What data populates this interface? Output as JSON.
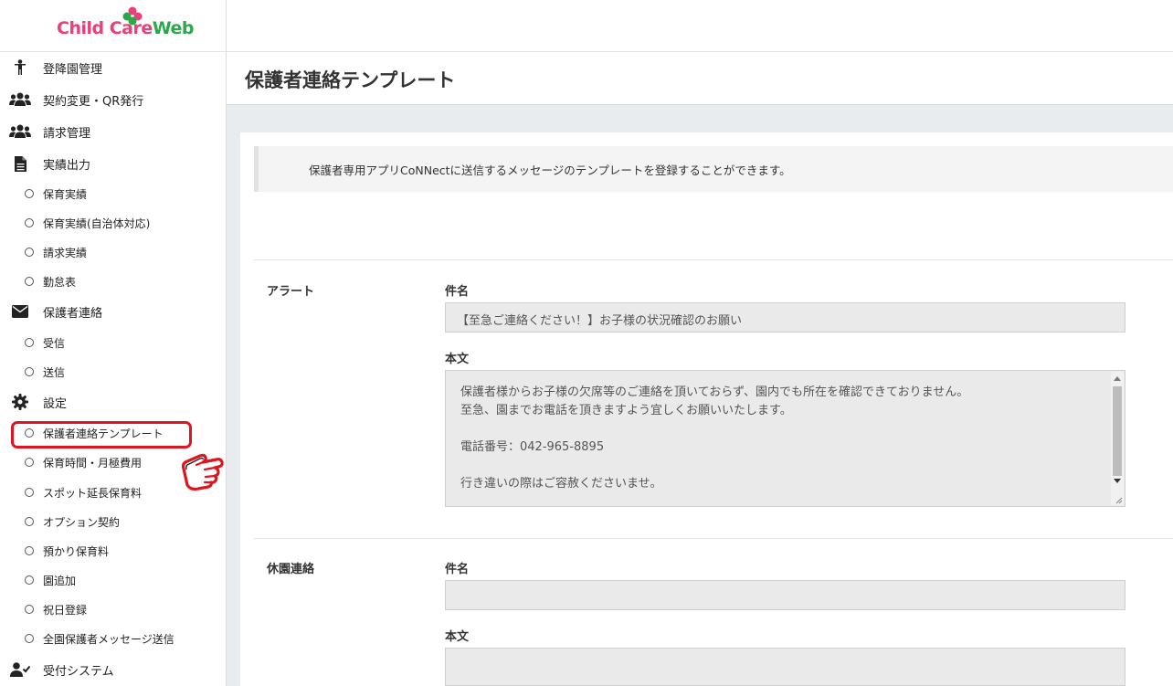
{
  "app": {
    "logo_part1": "Child Care",
    "logo_part2": "Web"
  },
  "sidebar": {
    "items": [
      {
        "label": "登降園管理",
        "icon": "child-icon"
      },
      {
        "label": "契約変更・QR発行",
        "icon": "users-icon"
      },
      {
        "label": "請求管理",
        "icon": "users-icon"
      },
      {
        "label": "実績出力",
        "icon": "document-icon"
      },
      {
        "label": "保育実績"
      },
      {
        "label": "保育実績(自治体対応)"
      },
      {
        "label": "請求実績"
      },
      {
        "label": "勤怠表"
      },
      {
        "label": "保護者連絡",
        "icon": "envelope-icon"
      },
      {
        "label": "受信"
      },
      {
        "label": "送信"
      },
      {
        "label": "設定",
        "icon": "gear-icon"
      },
      {
        "label": "保護者連絡テンプレート"
      },
      {
        "label": "保育時間・月極費用"
      },
      {
        "label": "スポット延長保育料"
      },
      {
        "label": "オプション契約"
      },
      {
        "label": "預かり保育料"
      },
      {
        "label": "園追加"
      },
      {
        "label": "祝日登録"
      },
      {
        "label": "全園保護者メッセージ送信"
      },
      {
        "label": "受付システム",
        "icon": "user-check-icon"
      }
    ]
  },
  "page": {
    "title": "保護者連絡テンプレート",
    "info": "保護者専用アプリCoNNectに送信するメッセージのテンプレートを登録することができます。"
  },
  "sections": [
    {
      "label": "アラート",
      "subject_label": "件名",
      "subject_value": "【至急ご連絡ください！】お子様の状況確認のお願い",
      "body_label": "本文",
      "body_lines": [
        "保護者様からお子様の欠席等のご連絡を頂いておらず、園内でも所在を確認できておりません。",
        "至急、園までお電話を頂きますよう宜しくお願いいたします。",
        "",
        "電話番号：042-965-8895",
        "",
        "行き違いの際はご容赦くださいませ。"
      ]
    },
    {
      "label": "休園連絡",
      "subject_label": "件名",
      "subject_value": "",
      "body_label": "本文"
    }
  ],
  "colors": {
    "logo_pink": "#e8417a",
    "logo_green": "#2aa84a",
    "highlight_red": "#e0141e"
  }
}
